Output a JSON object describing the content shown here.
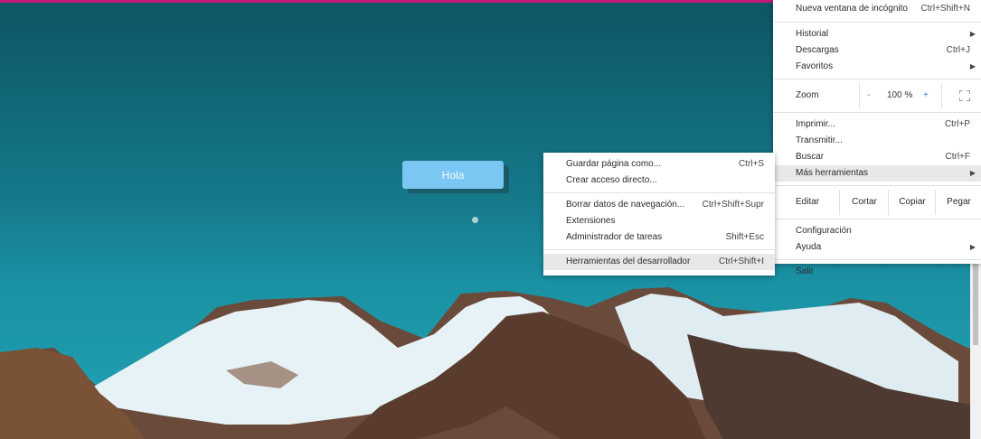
{
  "colors": {
    "accent_bar": "#c2187a",
    "sky_top": "#0d5564",
    "sky_bottom": "#22a2b3",
    "button": "#7bc7f3"
  },
  "page": {
    "button_label": "Hola"
  },
  "main_menu": {
    "incognito": {
      "label": "Nueva ventana de incógnito",
      "shortcut": "Ctrl+Shift+N"
    },
    "history": {
      "label": "Historial"
    },
    "downloads": {
      "label": "Descargas",
      "shortcut": "Ctrl+J"
    },
    "bookmarks": {
      "label": "Favoritos"
    },
    "zoom": {
      "label": "Zoom",
      "minus": "-",
      "value": "100 %",
      "plus": "+",
      "fullscreen_icon": "fullscreen-icon"
    },
    "print": {
      "label": "Imprimir...",
      "shortcut": "Ctrl+P"
    },
    "cast": {
      "label": "Transmitir..."
    },
    "find": {
      "label": "Buscar",
      "shortcut": "Ctrl+F"
    },
    "more_tools": {
      "label": "Más herramientas"
    },
    "edit": {
      "label": "Editar",
      "cut": "Cortar",
      "copy": "Copiar",
      "paste": "Pegar"
    },
    "settings": {
      "label": "Configuración"
    },
    "help": {
      "label": "Ayuda"
    },
    "exit": {
      "label": "Salir"
    }
  },
  "sub_menu": {
    "save_page": {
      "label": "Guardar página como...",
      "shortcut": "Ctrl+S"
    },
    "create_shortcut": {
      "label": "Crear acceso directo..."
    },
    "clear_data": {
      "label": "Borrar datos de navegación...",
      "shortcut": "Ctrl+Shift+Supr"
    },
    "extensions": {
      "label": "Extensiones"
    },
    "task_manager": {
      "label": "Administrador de tareas",
      "shortcut": "Shift+Esc"
    },
    "dev_tools": {
      "label": "Herramientas del desarrollador",
      "shortcut": "Ctrl+Shift+I"
    }
  }
}
